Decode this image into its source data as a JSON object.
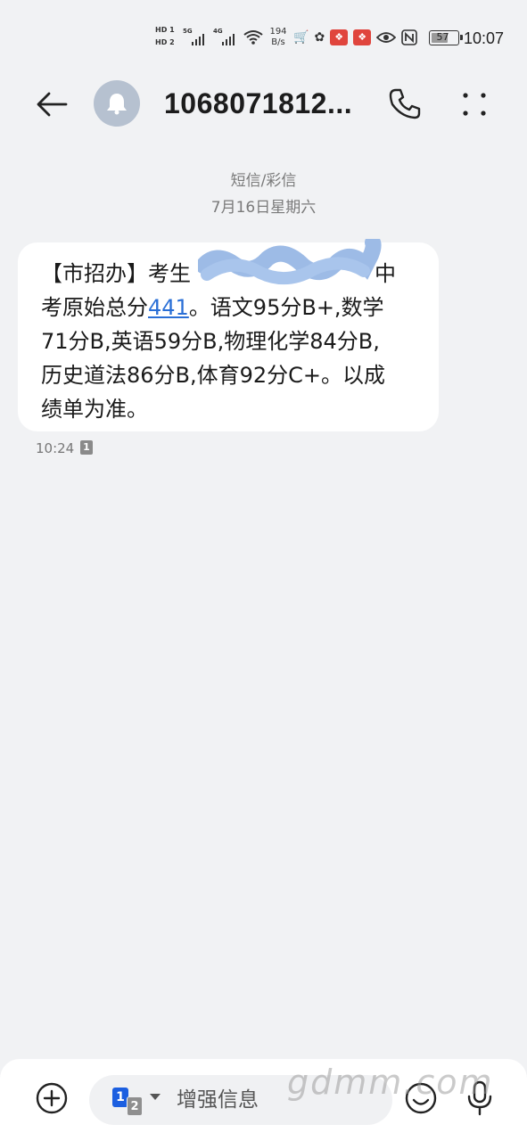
{
  "status_bar": {
    "hd1": "HD 1",
    "hd2": "HD 2",
    "sig1_gen": "5G",
    "sig2_gen": "4G",
    "wifi_gen": "6",
    "speed_value": "194",
    "speed_unit": "B/s",
    "battery": "57",
    "time": "10:07",
    "icons": [
      "hd-icon",
      "signal-icon",
      "wifi-icon",
      "cart-icon",
      "notification-icon",
      "app-icon",
      "eye-icon",
      "nfc-icon",
      "battery-icon"
    ]
  },
  "header": {
    "contact": "1068071812...",
    "icons": [
      "back-arrow-icon",
      "bell-avatar-icon",
      "phone-icon",
      "more-vertical-icon"
    ]
  },
  "conversation": {
    "label": "短信/彩信",
    "date": "7月16日星期六",
    "message": {
      "line1_a": "【市招办】考生",
      "line1_b": "中",
      "line2_a": "考原始总分",
      "line2_link": "441",
      "line2_b": "。语文95分B+,数学",
      "line3": "71分B,英语59分B,物理化学84分B,",
      "line4": "历史道法86分B,体育92分C+。以成",
      "line5": "绩单为准。"
    },
    "time": "10:24",
    "sim": "1"
  },
  "composer": {
    "sim1": "1",
    "sim2": "2",
    "placeholder": "增强信息",
    "icons": [
      "add-icon",
      "emoji-icon",
      "mic-icon"
    ]
  },
  "watermark": "gdmm.com",
  "colors": {
    "background": "#f1f2f4",
    "link": "#2a6fd6",
    "sim1": "#1c5fe0",
    "avatar": "#b6c1d0",
    "redaction": "#9dbbe6"
  }
}
